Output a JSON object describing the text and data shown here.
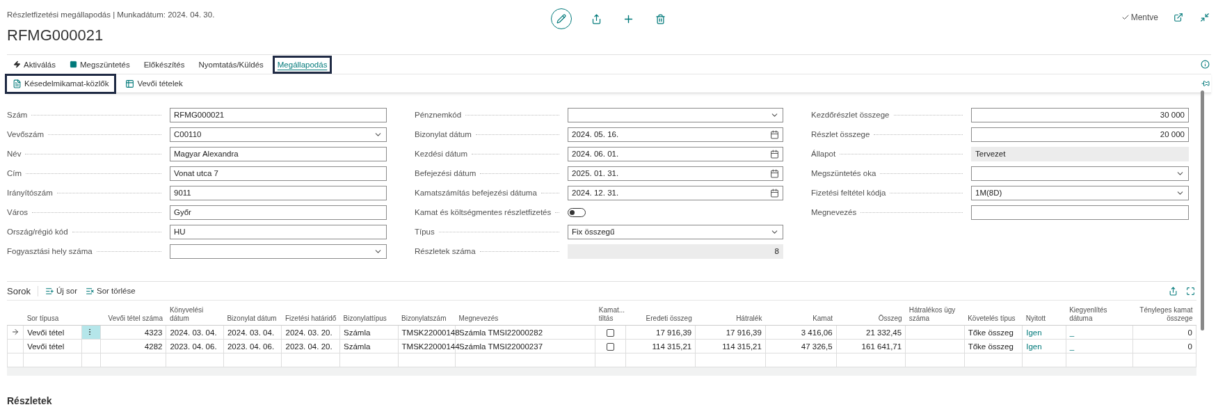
{
  "header": {
    "caption": "Részletfizetési megállapodás | Munkadátum: 2024. 04. 30.",
    "title": "RFMG000021",
    "status": "Mentve"
  },
  "tabs": [
    {
      "label": "Aktiválás",
      "selected": false,
      "highlighted": false
    },
    {
      "label": "Megszüntetés",
      "selected": false,
      "highlighted": false
    },
    {
      "label": "Előkészítés",
      "selected": false,
      "highlighted": false
    },
    {
      "label": "Nyomtatás/Küldés",
      "selected": false,
      "highlighted": false
    },
    {
      "label": "Megállapodás",
      "selected": true,
      "highlighted": true
    }
  ],
  "actions": [
    {
      "label": "Késedelmikamat-közlők",
      "highlighted": true
    },
    {
      "label": "Vevői tételek",
      "highlighted": false
    }
  ],
  "form": {
    "columns": [
      [
        {
          "label": "Szám",
          "kind": "text",
          "value": "RFMG000021"
        },
        {
          "label": "Vevőszám",
          "kind": "select",
          "value": "C00110"
        },
        {
          "label": "Név",
          "kind": "text",
          "value": "Magyar Alexandra"
        },
        {
          "label": "Cím",
          "kind": "text",
          "value": "Vonat utca 7"
        },
        {
          "label": "Irányítószám",
          "kind": "text",
          "value": "9011"
        },
        {
          "label": "Város",
          "kind": "text",
          "value": "Győr"
        },
        {
          "label": "Ország/régió kód",
          "kind": "text",
          "value": "HU"
        },
        {
          "label": "Fogyasztási hely száma",
          "kind": "select"
        }
      ],
      [
        {
          "label": "Pénznemkód",
          "kind": "select"
        },
        {
          "label": "Bizonylat dátum",
          "kind": "date",
          "value": "2024. 05. 16."
        },
        {
          "label": "Kezdési dátum",
          "kind": "date",
          "value": "2024. 06. 01."
        },
        {
          "label": "Befejezési dátum",
          "kind": "date",
          "value": "2025. 01. 31."
        },
        {
          "label": "Kamatszámítás befejezési dátuma",
          "kind": "date",
          "value": "2024. 12. 31."
        },
        {
          "label": "Kamat és költségmentes részletfizetés",
          "kind": "toggle",
          "on": false
        },
        {
          "label": "Típus",
          "kind": "select",
          "value": "Fix összegű"
        },
        {
          "label": "Részletek száma",
          "kind": "readonly_number",
          "value": "8"
        }
      ],
      [
        {
          "label": "Kezdőrészlet összege",
          "kind": "number",
          "value": "30 000"
        },
        {
          "label": "Részlet összege",
          "kind": "number",
          "value": "20 000"
        },
        {
          "label": "Állapot",
          "kind": "readonly",
          "value": "Tervezet"
        },
        {
          "label": "Megszüntetés oka",
          "kind": "select"
        },
        {
          "label": "Fizetési feltétel kódja",
          "kind": "select",
          "value": "1M(8D)"
        },
        {
          "label": "Megnevezés",
          "kind": "text"
        }
      ]
    ]
  },
  "lines": {
    "title": "Sorok",
    "actions": [
      {
        "label": "Új sor"
      },
      {
        "label": "Sor törlése"
      }
    ],
    "columns": [
      {
        "label": "Sor típusa",
        "kind": "text"
      },
      {
        "label": "Vevői tétel száma",
        "kind": "number"
      },
      {
        "label": "Könyvelési dátum",
        "kind": "text"
      },
      {
        "label": "Bizonylat dátum",
        "kind": "text"
      },
      {
        "label": "Fizetési határidő",
        "kind": "text"
      },
      {
        "label": "Bizonylattípus",
        "kind": "text"
      },
      {
        "label": "Bizonylatszám",
        "kind": "text"
      },
      {
        "label": "Megnevezés",
        "kind": "text"
      },
      {
        "label": "Kamat... tiltás",
        "kind": "check"
      },
      {
        "label": "Eredeti összeg",
        "kind": "number"
      },
      {
        "label": "Hátralék",
        "kind": "number"
      },
      {
        "label": "Kamat",
        "kind": "number"
      },
      {
        "label": "Összeg",
        "kind": "number"
      },
      {
        "label": "Hátralékos ügy száma",
        "kind": "text"
      },
      {
        "label": "Követelés típus",
        "kind": "text"
      },
      {
        "label": "Nyitott",
        "kind": "link"
      },
      {
        "label": "Kiegyenlítés dátuma",
        "kind": "link"
      },
      {
        "label": "Tényleges kamat összege",
        "kind": "number"
      }
    ],
    "rows": [
      {
        "selected": true,
        "cells": [
          "Vevői tétel",
          "4323",
          "2024. 03. 04.",
          "2024. 03. 04.",
          "2024. 03. 20.",
          "Számla",
          "TMSK22000148",
          "Számla TMSI22000282",
          false,
          "17 916,39",
          "17 916,39",
          "3 416,06",
          "21 332,45",
          null,
          "Tőke összeg",
          "Igen",
          "_",
          "0"
        ]
      },
      {
        "selected": false,
        "cells": [
          "Vevői tétel",
          "4282",
          "2023. 04. 06.",
          "2023. 04. 06.",
          "2023. 04. 20.",
          "Számla",
          "TMSK22000144",
          "Számla TMSI22000237",
          false,
          "114 315,21",
          "114 315,21",
          "47 326,5",
          "161 641,71",
          null,
          "Tőke összeg",
          "Igen",
          "_",
          "0"
        ]
      }
    ]
  },
  "next_section": "Részletek"
}
